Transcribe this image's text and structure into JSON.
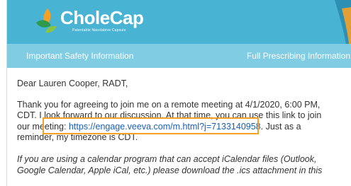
{
  "brand": {
    "name": "CholeCap",
    "tagline": "Patentable Nasolabive Capsule",
    "colors": {
      "header": "#49b3d3",
      "navbar": "#7fcce3",
      "link": "#1a5fb4",
      "highlight": "#f5a128"
    }
  },
  "nav": {
    "left_label": "Important Safety Information",
    "right_label": "Full Prescribing Information"
  },
  "email": {
    "greeting": "Dear Lauren Cooper, RADT,",
    "para1_text_a": "Thank you for agreeing to join me on a remote meeting at 4/1/2020, 6:00 PM, CDT. I look forward to our discussion. At that time, you can use this link to join our meeting: ",
    "meeting_link": "https://engage.veeva.com/m.html?j=7133140958",
    "para1_text_b": ". Just as a reminder, my timezone is CDT.",
    "para2_text": "If you are using a calendar program that can accept iCalendar files (Outlook, Google Calendar, Apple iCal, etc.) please download the .ics attachment in this"
  },
  "icons": {
    "logo": "leaf-logo-icon",
    "corner": "decorative-swoosh-icon"
  }
}
